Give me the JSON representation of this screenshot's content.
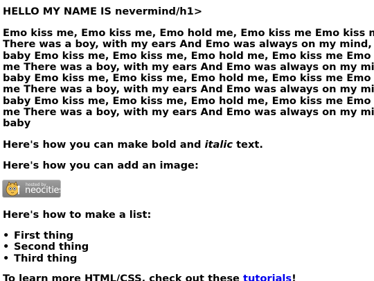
{
  "heading": "HELLO MY NAME IS nevermind/h1>",
  "lyrics_rows": [
    "Emo kiss me, Emo kiss me, Emo hold me, Emo kiss me Emo kiss me",
    "There was a boy, with my ears And Emo was always on my mind,",
    "baby Emo kiss me, Emo kiss me, Emo hold me, Emo kiss me Emo kiss",
    "me There was a boy, with my ears And Emo was always on my mind,",
    "baby Emo kiss me, Emo kiss me, Emo hold me, Emo kiss me Emo kiss",
    "me There was a boy, with my ears And Emo was always on my mind,",
    "baby Emo kiss me, Emo kiss me, Emo hold me, Emo kiss me Emo kiss",
    "me There was a boy, with my ears And Emo was always on my mind,",
    "baby"
  ],
  "bold_italic_line": {
    "prefix": "Here's how you can make bold and ",
    "italic": "italic",
    "suffix": " text."
  },
  "image_line": "Here's how you can add an image:",
  "badge": {
    "small_text": "hosted by",
    "big_text": "neocities"
  },
  "list_heading": "Here's how to make a list:",
  "list_items": [
    "First thing",
    "Second thing",
    "Third thing"
  ],
  "learn_line": {
    "prefix": "To learn more HTML/CSS, check out these ",
    "link": "tutorials",
    "suffix": "!"
  },
  "colors": {
    "link": "#0000ee",
    "text": "#000000",
    "background": "#ffffff"
  }
}
